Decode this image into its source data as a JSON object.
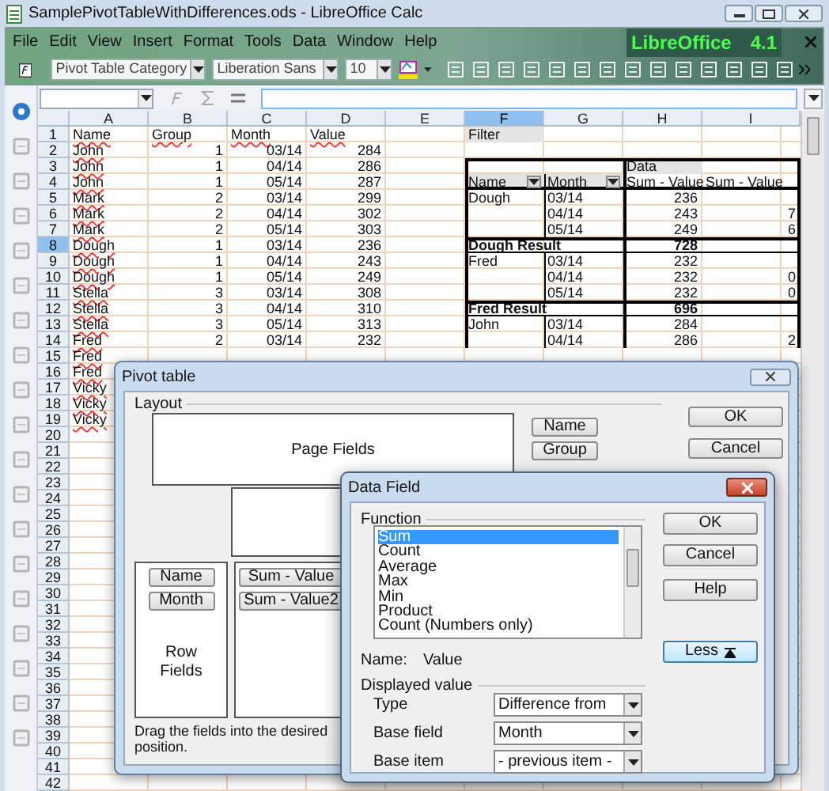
{
  "window": {
    "title": "SamplePivotTableWithDifferences.ods - LibreOffice Calc"
  },
  "menu": [
    "File",
    "Edit",
    "View",
    "Insert",
    "Format",
    "Tools",
    "Data",
    "Window",
    "Help"
  ],
  "brand": {
    "name": "LibreOffice",
    "version": "4.1"
  },
  "toolbar": {
    "style": "Pivot Table Category",
    "font": "Liberation Sans",
    "size": "10"
  },
  "sheet": {
    "columns": [
      {
        "label": "A",
        "selected": false
      },
      {
        "label": "B",
        "selected": false
      },
      {
        "label": "C",
        "selected": false
      },
      {
        "label": "D",
        "selected": false
      },
      {
        "label": "E",
        "selected": false
      },
      {
        "label": "F",
        "selected": true
      },
      {
        "label": "G",
        "selected": false
      },
      {
        "label": "H",
        "selected": false
      },
      {
        "label": "I",
        "selected": false
      }
    ],
    "rows": [
      {
        "label": "1",
        "selected": false
      },
      {
        "label": "2",
        "selected": false
      },
      {
        "label": "3",
        "selected": false
      },
      {
        "label": "4",
        "selected": false
      },
      {
        "label": "5",
        "selected": false
      },
      {
        "label": "6",
        "selected": false
      },
      {
        "label": "7",
        "selected": false
      },
      {
        "label": "8",
        "selected": true
      },
      {
        "label": "9",
        "selected": false
      },
      {
        "label": "10",
        "selected": false
      },
      {
        "label": "11",
        "selected": false
      },
      {
        "label": "12",
        "selected": false
      },
      {
        "label": "13",
        "selected": false
      },
      {
        "label": "14",
        "selected": false
      },
      {
        "label": "15",
        "selected": false
      },
      {
        "label": "16",
        "selected": false
      },
      {
        "label": "17",
        "selected": false
      },
      {
        "label": "18",
        "selected": false
      },
      {
        "label": "19",
        "selected": false
      },
      {
        "label": "20",
        "selected": false
      },
      {
        "label": "21",
        "selected": false
      },
      {
        "label": "22",
        "selected": false
      },
      {
        "label": "23",
        "selected": false
      },
      {
        "label": "24",
        "selected": false
      },
      {
        "label": "25",
        "selected": false
      },
      {
        "label": "26",
        "selected": false
      },
      {
        "label": "27",
        "selected": false
      },
      {
        "label": "28",
        "selected": false
      },
      {
        "label": "29",
        "selected": false
      },
      {
        "label": "30",
        "selected": false
      },
      {
        "label": "31",
        "selected": false
      },
      {
        "label": "32",
        "selected": false
      },
      {
        "label": "33",
        "selected": false
      },
      {
        "label": "34",
        "selected": false
      },
      {
        "label": "35",
        "selected": false
      },
      {
        "label": "36",
        "selected": false
      },
      {
        "label": "37",
        "selected": false
      },
      {
        "label": "38",
        "selected": false
      },
      {
        "label": "39",
        "selected": false
      },
      {
        "label": "40",
        "selected": false
      },
      {
        "label": "41",
        "selected": false
      },
      {
        "label": "42",
        "selected": false
      }
    ]
  },
  "source_table": {
    "header": [
      "Name",
      "Group",
      "Month",
      "Value"
    ],
    "rows": [
      {
        "name": "John",
        "group": "1",
        "month": "03/14",
        "value": "284"
      },
      {
        "name": "John",
        "group": "1",
        "month": "04/14",
        "value": "286"
      },
      {
        "name": "John",
        "group": "1",
        "month": "05/14",
        "value": "287"
      },
      {
        "name": "Mark",
        "group": "2",
        "month": "03/14",
        "value": "299"
      },
      {
        "name": "Mark",
        "group": "2",
        "month": "04/14",
        "value": "302"
      },
      {
        "name": "Mark",
        "group": "2",
        "month": "05/14",
        "value": "303"
      },
      {
        "name": "Dough",
        "group": "1",
        "month": "03/14",
        "value": "236"
      },
      {
        "name": "Dough",
        "group": "1",
        "month": "04/14",
        "value": "243"
      },
      {
        "name": "Dough",
        "group": "1",
        "month": "05/14",
        "value": "249"
      },
      {
        "name": "Stella",
        "group": "3",
        "month": "03/14",
        "value": "308"
      },
      {
        "name": "Stella",
        "group": "3",
        "month": "04/14",
        "value": "310"
      },
      {
        "name": "Stella",
        "group": "3",
        "month": "05/14",
        "value": "313"
      },
      {
        "name": "Fred",
        "group": "2",
        "month": "03/14",
        "value": "232"
      },
      {
        "name": "Fred"
      },
      {
        "name": "Fred"
      },
      {
        "name": "Vicky"
      },
      {
        "name": "Vicky"
      },
      {
        "name": "Vicky"
      }
    ]
  },
  "pivot": {
    "filter": "Filter",
    "data_label": "Data",
    "columns": [
      {
        "label": "Name",
        "kind": "field"
      },
      {
        "label": "Month",
        "kind": "field"
      },
      {
        "label": "Sum - Value",
        "kind": "data"
      },
      {
        "label": "Sum - Value",
        "kind": "data"
      }
    ],
    "groups": [
      {
        "name": "Dough",
        "rows": [
          {
            "month": "03/14",
            "value": "236"
          },
          {
            "month": "04/14",
            "value": "243",
            "difference": "7"
          },
          {
            "month": "05/14",
            "value": "249",
            "difference": "6"
          }
        ],
        "result_label": "Dough Result",
        "result_value": "728"
      },
      {
        "name": "Fred",
        "rows": [
          {
            "month": "03/14",
            "value": "232"
          },
          {
            "month": "04/14",
            "value": "232",
            "difference": "0"
          },
          {
            "month": "05/14",
            "value": "232",
            "difference": "0"
          }
        ],
        "result_label": "Fred Result",
        "result_value": "696"
      },
      {
        "name": "John",
        "rows": [
          {
            "month": "03/14",
            "value": "284"
          },
          {
            "month": "04/14",
            "value": "286",
            "difference": "2"
          }
        ]
      }
    ]
  },
  "pivot_dialog": {
    "title": "Pivot table",
    "layout_label": "Layout",
    "page_fields_label": "Page Fields",
    "row_fields_label": "Row Fields",
    "row_fields": [
      "Name",
      "Month"
    ],
    "data_fields": [
      "Sum - Value",
      "Sum - Value2"
    ],
    "field_list": [
      "Name",
      "Group"
    ],
    "buttons": [
      "OK",
      "Cancel"
    ],
    "hint": "Drag the fields into the desired position."
  },
  "data_field_dialog": {
    "title": "Data Field",
    "function_label": "Function",
    "functions": [
      {
        "label": "Sum",
        "selected": true
      },
      {
        "label": "Count",
        "selected": false
      },
      {
        "label": "Average",
        "selected": false
      },
      {
        "label": "Max",
        "selected": false
      },
      {
        "label": "Min",
        "selected": false
      },
      {
        "label": "Product",
        "selected": false
      },
      {
        "label": "Count (Numbers only)",
        "selected": false
      }
    ],
    "name_label": "Name:",
    "name_value": "Value",
    "displayed_value_label": "Displayed value",
    "settings": [
      {
        "label": "Type",
        "value": "Difference from"
      },
      {
        "label": "Base field",
        "value": "Month"
      },
      {
        "label": "Base item",
        "value": "- previous item -"
      }
    ],
    "buttons": [
      "OK",
      "Cancel",
      "Help"
    ],
    "less_button": "Less"
  }
}
